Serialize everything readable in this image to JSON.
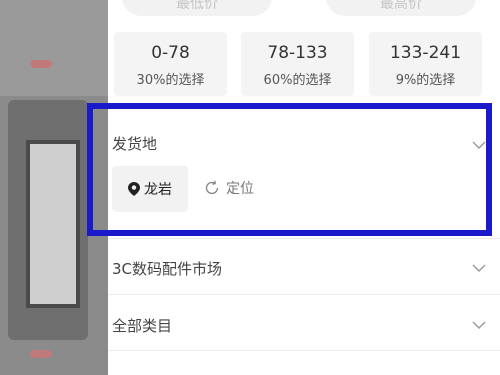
{
  "price": {
    "min_placeholder": "最低价",
    "max_placeholder": "最高价",
    "ranges": [
      {
        "range": "0-78",
        "share": "30%的选择"
      },
      {
        "range": "78-133",
        "share": "60%的选择"
      },
      {
        "range": "133-241",
        "share": "9%的选择"
      }
    ]
  },
  "shipping": {
    "title": "发货地",
    "current_location": "龙岩",
    "locate_label": "定位"
  },
  "market": {
    "title": "3C数码配件市场"
  },
  "category": {
    "title": "全部类目"
  },
  "colors": {
    "highlight": "#1a1acb",
    "chip_bg": "#f2f2f2"
  }
}
